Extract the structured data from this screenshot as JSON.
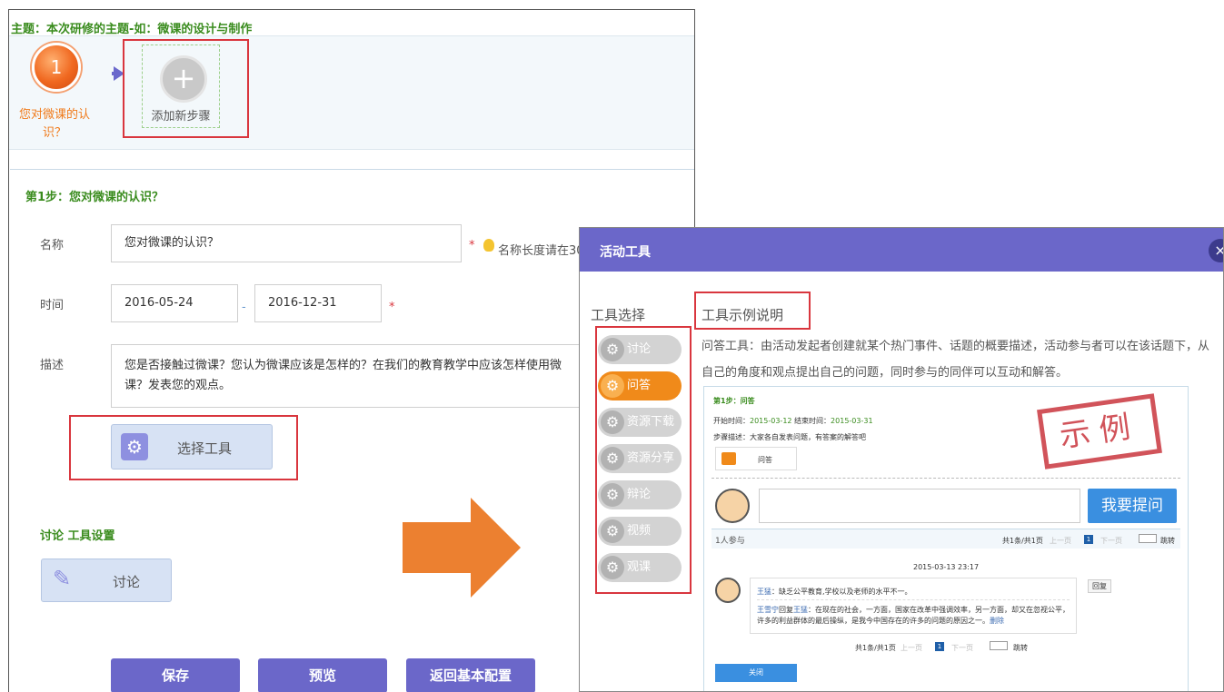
{
  "topic": "主题：本次研修的主题-如：微课的设计与制作",
  "steps": {
    "step1_number": "1",
    "step1_label": "您对微课的认识？",
    "add_step_label": "添加新步骤"
  },
  "form": {
    "section_title": "第1步：您对微课的认识？",
    "name_label": "名称",
    "name_value": "您对微课的认识？",
    "name_hint": "名称长度请在30",
    "time_label": "时间",
    "start_date": "2016-05-24",
    "date_separator": "-",
    "end_date": "2016-12-31",
    "desc_label": "描述",
    "desc_value": "您是否接触过微课？您认为微课应该是怎样的？在我们的教育教学中应该怎样使用微课？发表您的观点。",
    "required_mark": "*",
    "choose_tool_label": "选择工具",
    "tool_settings_label": "讨论 工具设置",
    "tool_discuss_label": "讨论",
    "save_label": "保存",
    "preview_label": "预览",
    "back_label": "返回基本配置"
  },
  "dialog": {
    "title": "活动工具",
    "close_glyph": "×",
    "tool_select_title": "工具选择",
    "tools": [
      "讨论",
      "问答",
      "资源下载",
      "资源分享",
      "辩论",
      "视频",
      "观课"
    ],
    "active_tool": "问答",
    "example_title": "工具示例说明",
    "description": "问答工具：由活动发起者创建就某个热门事件、话题的概要描述，活动参与者可以在该话题下，从自己的角度和观点提出自己的问题，同时参与的同伴可以互动和解答。",
    "preview": {
      "step_title": "第1步：问答",
      "start_label": "开始时间：",
      "start_time": "2015-03-12",
      "end_label": "结束时间：",
      "end_time": "2015-03-31",
      "step_desc_label": "步骤描述：",
      "step_desc": "大家各自发表问题，有答案的解答吧",
      "tool_chip": "问答",
      "stamp": "示例",
      "ask_button": "我要提问",
      "participants": "1人参与",
      "pager_text": "共1条/共1页",
      "prev": "上一页",
      "page": "1",
      "next": "下一页",
      "jump": "跳转",
      "timestamp": "2015-03-13 23:17",
      "post_author": "王猛",
      "post_text": "：缺乏公平教育,学校以及老师的水平不一。",
      "reply_button": "回复",
      "reply_author": "王雪宁",
      "reply_mid": "回复",
      "reply_target": "王猛",
      "reply_text": "：在现在的社会，一方面，国家在改革中强调效率，另一方面，却又在忽视公平，许多的利益群体的最后操纵，是我今中国存在的许多的问题的原因之一。",
      "reply_del": "删除",
      "close_button": "关闭"
    }
  },
  "colors": {
    "accent_purple": "#6b67c9",
    "orange": "#ec8030",
    "green_title": "#3a8c1e",
    "highlight_red": "#d9363e"
  }
}
